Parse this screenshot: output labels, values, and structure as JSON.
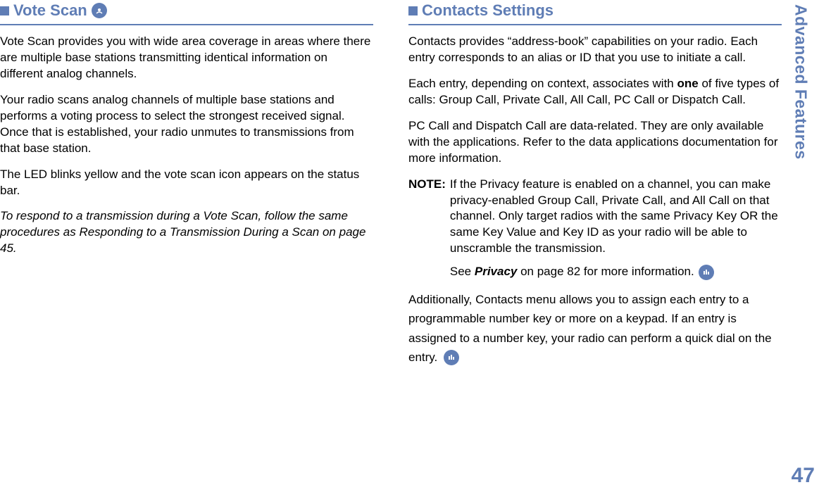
{
  "sideTitle": "Advanced Features",
  "pageNumber": "47",
  "left": {
    "heading": "Vote Scan",
    "p1": "Vote Scan provides you with wide area coverage in areas where there are multiple base stations transmitting identical information on different analog channels.",
    "p2": "Your radio scans analog channels of multiple base stations and performs a voting process to select the strongest received signal. Once that is established, your radio unmutes to transmissions from that base station.",
    "p3": "The LED blinks yellow and the vote scan icon appears on the status bar.",
    "p4": "To respond to a transmission during a Vote Scan, follow the same procedures as Responding to a Transmission During a Scan on page 45."
  },
  "right": {
    "heading": "Contacts Settings",
    "p1": "Contacts provides “address-book” capabilities on your radio. Each entry corresponds to an alias or ID that you use to initiate a call.",
    "p2a": "Each entry, depending on context, associates with ",
    "p2b": "one",
    "p2c": " of five types of calls: Group Call, Private Call, All Call, PC Call or Dispatch Call.",
    "p3": "PC Call and Dispatch Call are data-related. They are only available with the applications. Refer to the data applications documentation for more information.",
    "noteLabel": "NOTE:",
    "noteBody": "If the Privacy feature is enabled on a channel, you can make privacy-enabled Group Call, Private Call, and All Call on that channel. Only target radios with the same Privacy Key OR the same Key Value and Key ID as your radio will be able to unscramble the transmission.",
    "noteSeeA": "See ",
    "noteSeeB": "Privacy",
    "noteSeeC": " on page 82 for more information.",
    "p4a": "Additionally, Contacts menu allows you to assign each entry to a programmable number key or more on a keypad. If an entry is assigned to a number key, your radio can perform a quick dial on the entry."
  }
}
